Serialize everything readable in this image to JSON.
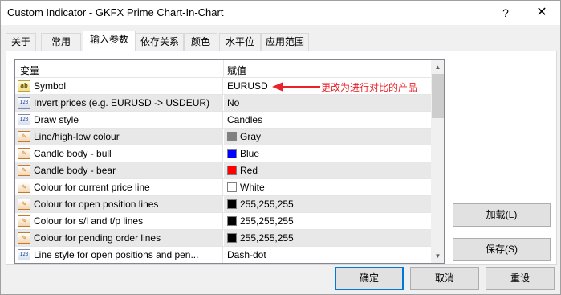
{
  "window": {
    "title": "Custom Indicator - GKFX Prime Chart-In-Chart",
    "help_label": "?",
    "close_label": "✕"
  },
  "tabs": [
    {
      "label": "关于"
    },
    {
      "label": "常用"
    },
    {
      "label": "输入参数"
    },
    {
      "label": "依存关系"
    },
    {
      "label": "颜色"
    },
    {
      "label": "水平位"
    },
    {
      "label": "应用范围"
    }
  ],
  "grid": {
    "col_variable": "变量",
    "col_value": "赋值",
    "rows": [
      {
        "icon": "string-icon",
        "icon_text": "ab",
        "name": "Symbol",
        "value": "EURUSD"
      },
      {
        "icon": "number-icon",
        "icon_text": "123",
        "name": "Invert prices (e.g. EURUSD -> USDEUR)",
        "value": "No"
      },
      {
        "icon": "number-icon",
        "icon_text": "123",
        "name": "Draw style",
        "value": "Candles"
      },
      {
        "icon": "color-icon",
        "icon_text": "✎",
        "name": "Line/high-low colour",
        "value": "Gray",
        "swatch": "#808080"
      },
      {
        "icon": "color-icon",
        "icon_text": "✎",
        "name": "Candle body - bull",
        "value": "Blue",
        "swatch": "#0000ff"
      },
      {
        "icon": "color-icon",
        "icon_text": "✎",
        "name": "Candle body - bear",
        "value": "Red",
        "swatch": "#ff0000"
      },
      {
        "icon": "color-icon",
        "icon_text": "✎",
        "name": "Colour for current price line",
        "value": "White",
        "swatch": "#ffffff"
      },
      {
        "icon": "color-icon",
        "icon_text": "✎",
        "name": "Colour for open position lines",
        "value": "255,255,255",
        "swatch": "#000000"
      },
      {
        "icon": "color-icon",
        "icon_text": "✎",
        "name": "Colour for s/l and t/p lines",
        "value": "255,255,255",
        "swatch": "#000000"
      },
      {
        "icon": "color-icon",
        "icon_text": "✎",
        "name": "Colour for pending order lines",
        "value": "255,255,255",
        "swatch": "#000000"
      },
      {
        "icon": "number-icon",
        "icon_text": "123",
        "name": "Line style for open positions and pen...",
        "value": "Dash-dot"
      }
    ]
  },
  "annotation": {
    "text": "更改为进行对比的产品",
    "color": "#e8232a"
  },
  "side_buttons": {
    "load": "加载(L)",
    "save": "保存(S)"
  },
  "bottom_buttons": {
    "ok": "确定",
    "cancel": "取消",
    "reset": "重设"
  },
  "colors": {
    "accent": "#0078d7",
    "row_shade": "#e8e8e8"
  }
}
